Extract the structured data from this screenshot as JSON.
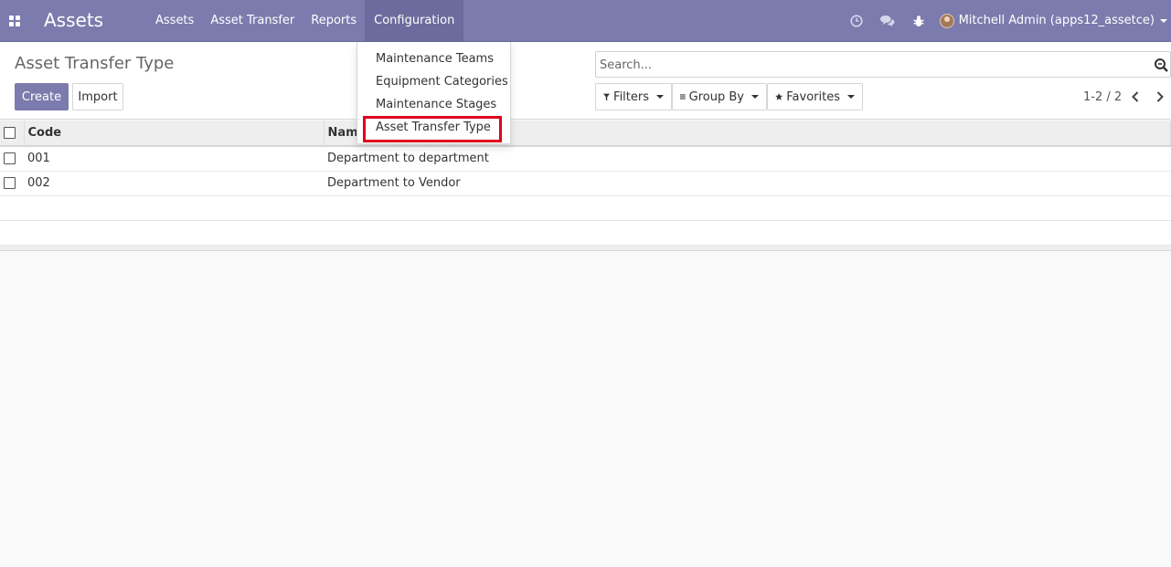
{
  "navbar": {
    "brand": "Assets",
    "menu": [
      "Assets",
      "Asset Transfer",
      "Reports",
      "Configuration"
    ],
    "active_menu": "Configuration",
    "user": "Mitchell Admin (apps12_assetce)"
  },
  "dropdown": {
    "items": [
      "Maintenance Teams",
      "Equipment Categories",
      "Maintenance Stages",
      "Asset Transfer Type"
    ],
    "highlighted": "Asset Transfer Type",
    "highlight_color": "#e1001d"
  },
  "control_panel": {
    "breadcrumb": "Asset Transfer Type",
    "create_label": "Create",
    "import_label": "Import",
    "search_placeholder": "Search...",
    "filters_label": "Filters",
    "group_by_label": "Group By",
    "favorites_label": "Favorites",
    "pager": "1-2 / 2"
  },
  "table": {
    "headers": [
      "Code",
      "Name"
    ],
    "rows": [
      {
        "code": "001",
        "name": "Department to department"
      },
      {
        "code": "002",
        "name": "Department to Vendor"
      }
    ]
  },
  "colors": {
    "navbar": "#7c7bad",
    "primary_button": "#7c7bad"
  }
}
